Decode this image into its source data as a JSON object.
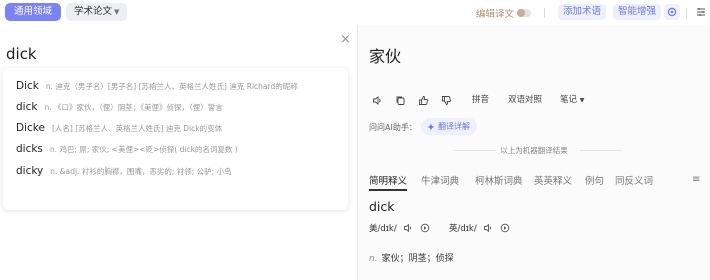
{
  "topbar": {
    "general_domain": "通用领域",
    "domain_select": "学术论文",
    "translate_mode": "编辑译文",
    "add_term": "添加术语",
    "smart_enhance": "智能增强"
  },
  "source": {
    "text": "dick"
  },
  "suggestions": [
    {
      "word": "Dick",
      "def": "n. 迪克（男子名）[男子名] [苏格兰人、英格兰人姓氏] 迪克 Richard的昵称"
    },
    {
      "word": "dick",
      "def": "n. 《口》家伙，（俚）阴茎；《美俚》侦探，（俚）誓言"
    },
    {
      "word": "Dicke",
      "def": "[人名] [苏格兰人、英格兰人姓氏] 迪克 Dick的变体"
    },
    {
      "word": "dicks",
      "def": "n. 鸡巴; 屌; 家伙; <美俚><贬>侦探( dick的名词复数 )"
    },
    {
      "word": "dicky",
      "def": "n. &adj. 衬衫的胸襟，围嘴，恶劣的; 衬领; 公驴; 小鸟"
    }
  ],
  "target": {
    "text": "家伙",
    "pinyin": "拼音",
    "bilingual": "双语对照",
    "notes": "笔记",
    "ai_label": "问问AI助手：",
    "ai_chip": "翻译详解",
    "mt_note": "以上为机器翻译结果"
  },
  "dict": {
    "tabs": [
      "简明释义",
      "牛津词典",
      "柯林斯词典",
      "英英释义",
      "例句",
      "同反义词"
    ],
    "headword": "dick",
    "pron_us": "美/dɪk/",
    "pron_uk": "英/dɪk/",
    "pos": "n.",
    "meaning": "家伙；阴茎；侦探"
  }
}
